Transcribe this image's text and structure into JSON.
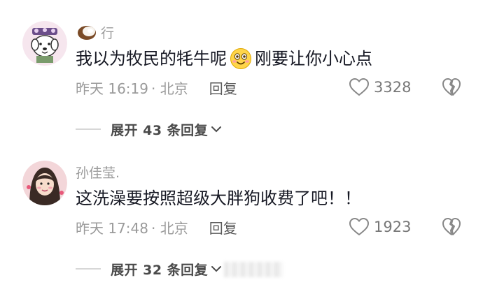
{
  "comments": [
    {
      "username": "行",
      "avatar_icon": "dog-avatar-icon",
      "badge_icon": "coconut-icon",
      "text_before": "我以为牧民的牦牛呢",
      "emoji_icon": "smile-emoji-icon",
      "text_after": "刚要让你小心点",
      "time": "昨天 16:19",
      "location": "· 北京",
      "reply_label": "回复",
      "like_count": "3328",
      "expand_label": "展开 43 条回复"
    },
    {
      "username": "孙佳莹.",
      "avatar_icon": "girl-avatar-icon",
      "text": "这洗澡要按照超级大胖狗收费了吧！！",
      "time": "昨天 17:48",
      "location": "· 北京",
      "reply_label": "回复",
      "like_count": "1923",
      "expand_label": "展开 32 条回复"
    }
  ],
  "colors": {
    "text": "#161823",
    "muted": "#9a9a9a",
    "divider": "#d7d7d7"
  }
}
